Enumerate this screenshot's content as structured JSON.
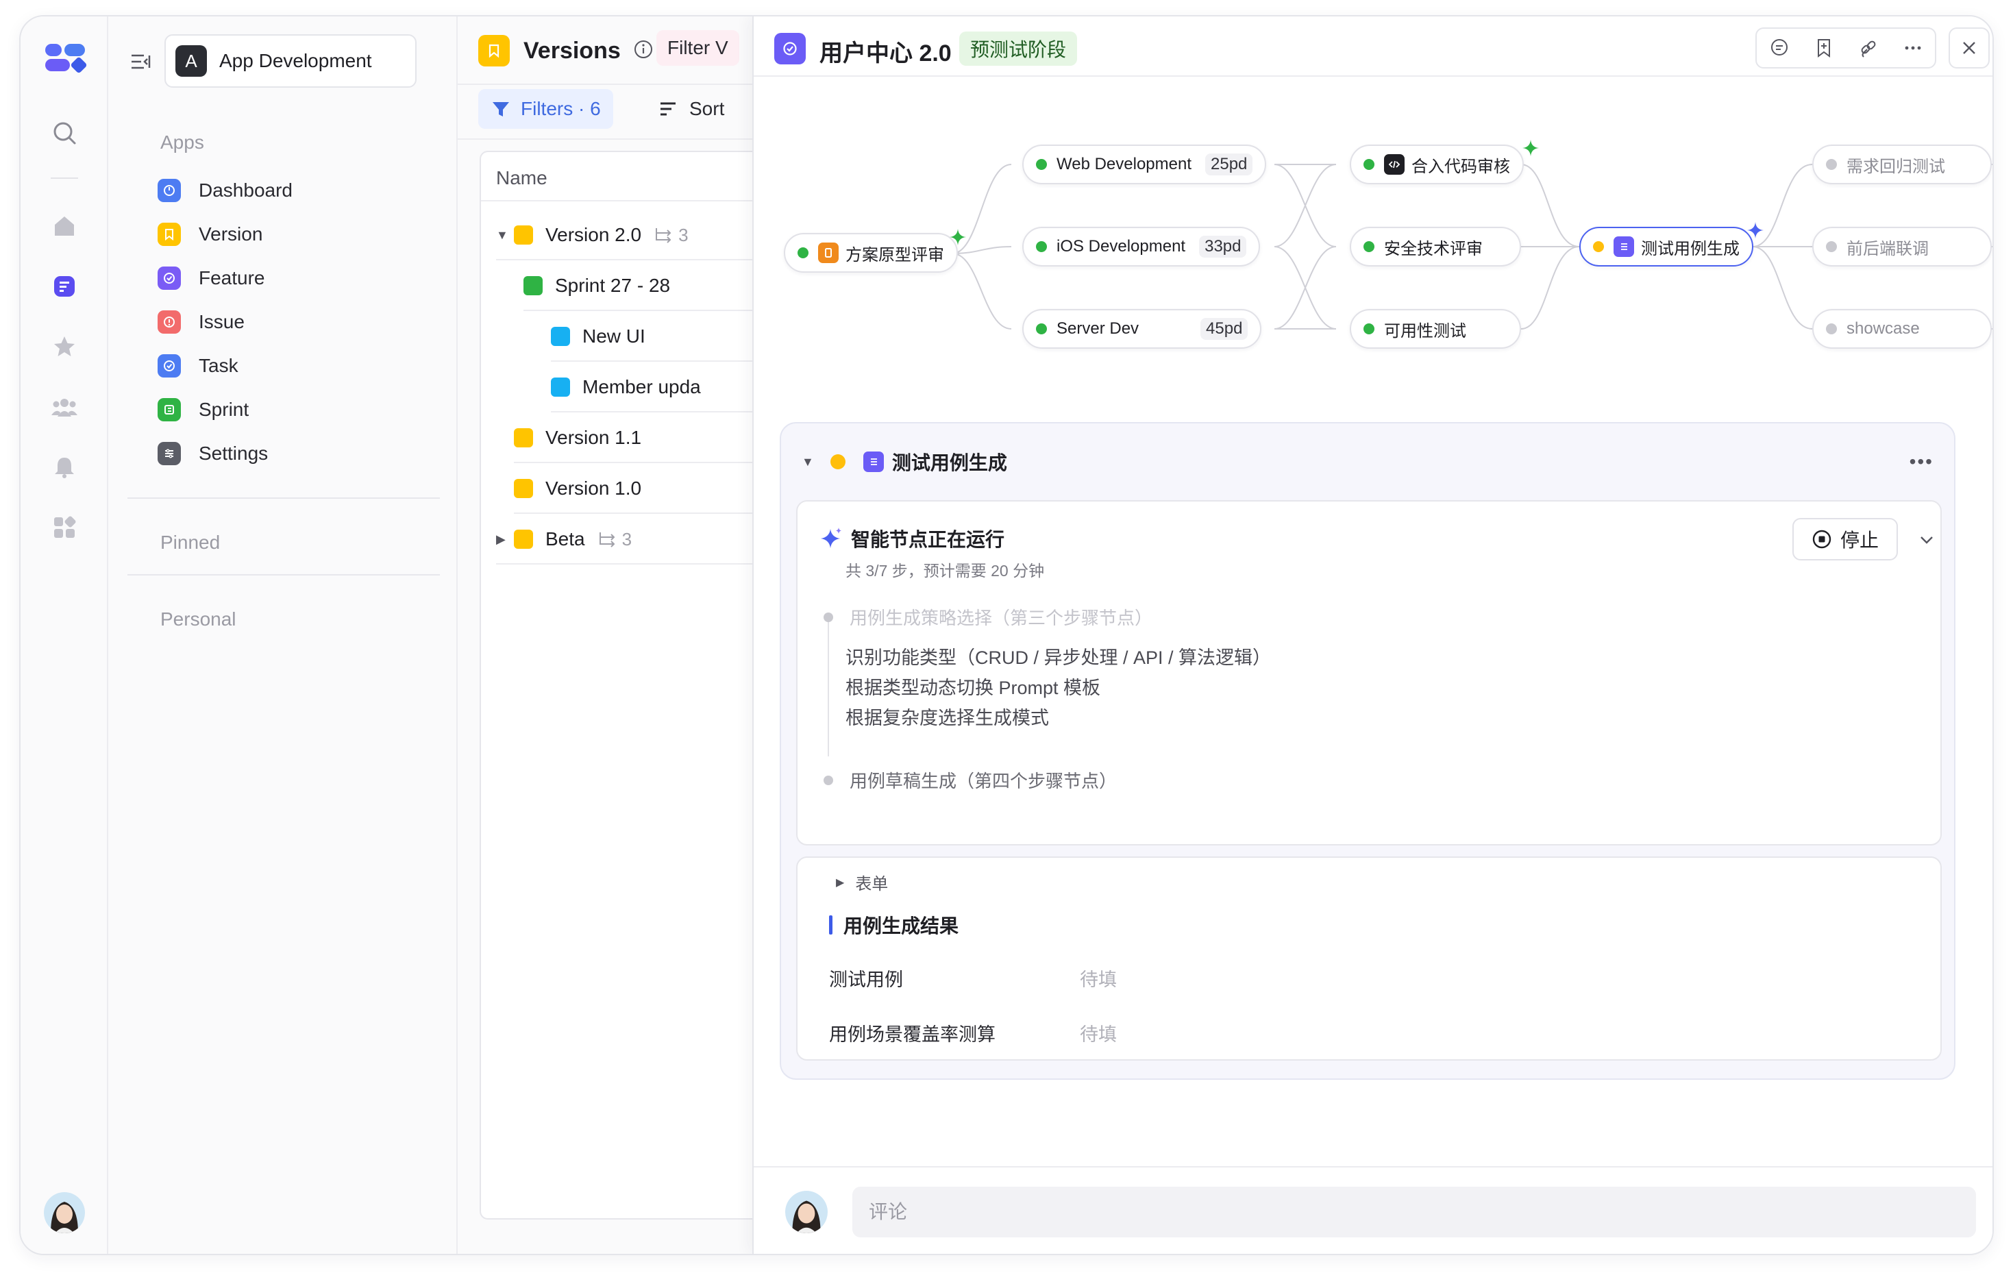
{
  "workspace": {
    "badge": "A",
    "name": "App Development"
  },
  "sidebar": {
    "apps_title": "Apps",
    "items": [
      {
        "label": "Dashboard",
        "icon": "dashboard-icon",
        "color": "#4d7cf2"
      },
      {
        "label": "Version",
        "icon": "version-icon",
        "color": "#ffc400"
      },
      {
        "label": "Feature",
        "icon": "feature-icon",
        "color": "#7a5cf5"
      },
      {
        "label": "Issue",
        "icon": "issue-icon",
        "color": "#f26b6b"
      },
      {
        "label": "Task",
        "icon": "task-icon",
        "color": "#4d7cf2"
      },
      {
        "label": "Sprint",
        "icon": "sprint-icon",
        "color": "#2fb344"
      },
      {
        "label": "Settings",
        "icon": "settings-icon",
        "color": "#5b5d66"
      }
    ],
    "pinned_title": "Pinned",
    "personal_title": "Personal"
  },
  "versions_panel": {
    "title": "Versions",
    "filter_view_label": "Filter V",
    "filters_label": "Filters · 6",
    "sort_label": "Sort",
    "column_name": "Name",
    "rows": [
      {
        "label": "Version 2.0",
        "count": "3",
        "color": "#ffc400",
        "caret": "▼"
      },
      {
        "label": "Sprint 27 - 28",
        "color": "#2fb344"
      },
      {
        "label": "New UI",
        "color": "#17b0f2"
      },
      {
        "label": "Member upda",
        "color": "#17b0f2"
      },
      {
        "label": "Version 1.1",
        "color": "#ffc400"
      },
      {
        "label": "Version 1.0",
        "color": "#ffc400"
      },
      {
        "label": "Beta",
        "count": "3",
        "color": "#ffc400",
        "caret": "▶"
      }
    ]
  },
  "detail": {
    "title": "用户中心 2.0",
    "stage": "预测试阶段",
    "flow": {
      "nodes": {
        "n1": "方案原型评审",
        "n2": "Web Development",
        "n2_pd": "25pd",
        "n3": "iOS Development",
        "n3_pd": "33pd",
        "n4": "Server Dev",
        "n4_pd": "45pd",
        "n5": "合入代码审核",
        "n6": "安全技术评审",
        "n7": "可用性测试",
        "n8": "测试用例生成",
        "n9": "需求回归测试",
        "n10": "前后端联调",
        "n11": "showcase"
      },
      "status_colors": {
        "done": "#2fb344",
        "running": "#ffbe0b",
        "pending": "#c9c9cf"
      }
    },
    "task": {
      "title": "测试用例生成",
      "run_title": "智能节点正在运行",
      "run_sub": "共 3/7 步，预计需要 20 分钟",
      "stop_label": "停止",
      "step_prev": "用例生成策略选择（第三个步骤节点）",
      "substeps": [
        "识别功能类型（CRUD / 异步处理 / API / 算法逻辑）",
        "根据类型动态切换 Prompt 模板",
        "根据复杂度选择生成模式"
      ],
      "step_current": "用例草稿生成（第四个步骤节点）",
      "form_toggle": "表单",
      "result_title": "用例生成结果",
      "fields": [
        {
          "label": "测试用例",
          "value": "待填"
        },
        {
          "label": "用例场景覆盖率测算",
          "value": "待填"
        }
      ]
    },
    "comment_placeholder": "评论"
  }
}
